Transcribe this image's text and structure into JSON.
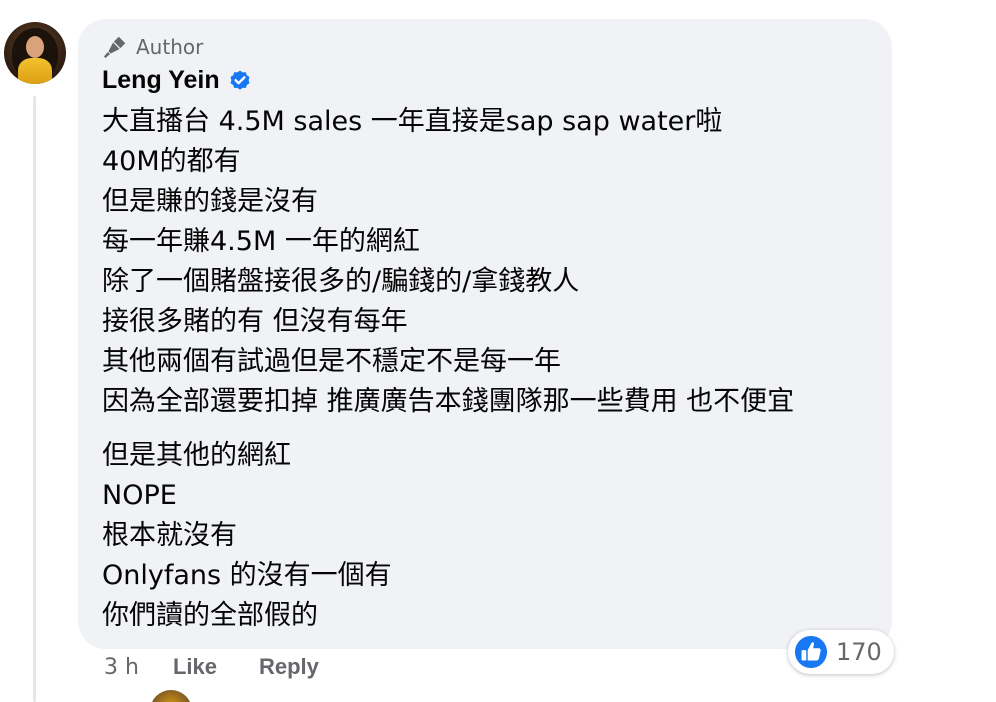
{
  "comment": {
    "author_badge": "Author",
    "author_name": "Leng Yein",
    "lines": [
      "大直播台 4.5M sales 一年直接是sap sap water啦",
      "40M的都有",
      "但是賺的錢是沒有",
      "每一年賺4.5M 一年的網紅",
      "除了一個賭盤接很多的/騙錢的/拿錢教人",
      "接很多賭的有 但沒有每年",
      "其他兩個有試過但是不穩定不是每一年",
      "因為全部還要扣掉 推廣廣告本錢團隊那一些費用 也不便宜"
    ],
    "lines2": [
      "但是其他的網紅",
      "NOPE",
      "根本就沒有",
      "Onlyfans 的沒有一個有",
      "你們讀的全部假的"
    ],
    "reaction_count": "170",
    "time": "3 h",
    "like_label": "Like",
    "reply_label": "Reply"
  },
  "colors": {
    "bubble_bg": "#f0f2f5",
    "secondary_text": "#65676b",
    "primary_text": "#050505",
    "facebook_blue": "#1877f2"
  },
  "icons": {
    "badge": "microphone-icon",
    "verified": "verified-badge-icon",
    "reaction": "like-thumb-icon"
  }
}
